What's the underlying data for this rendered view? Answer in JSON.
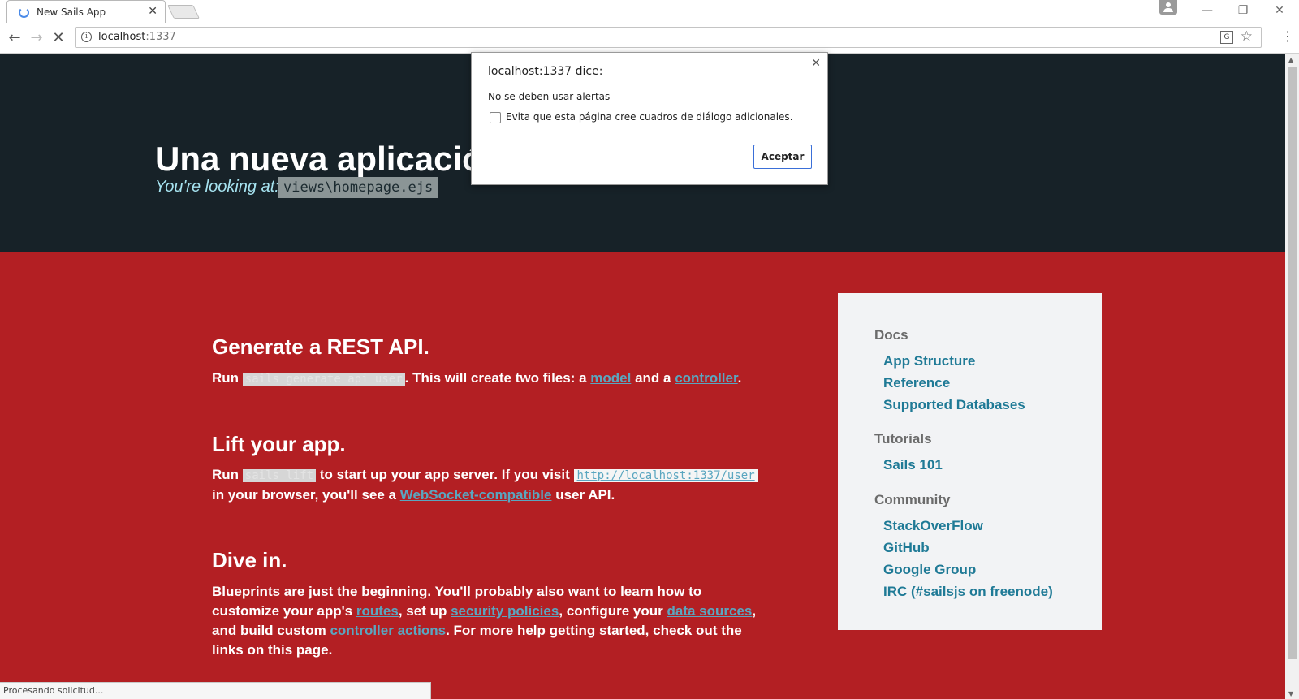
{
  "browser": {
    "tab_title": "New Sails App",
    "url_host": "localhost",
    "url_port": ":1337",
    "status_text": "Procesando solicitud..."
  },
  "header": {
    "title": "Una nueva aplicació",
    "looking_label": "You're looking at:",
    "file_path": "views\\homepage.ejs"
  },
  "sections": {
    "rest": {
      "title": "Generate a REST API.",
      "run": "Run",
      "command": "sails generate api user",
      "text1": ". This will create two files: a ",
      "link_model": "model",
      "and": " and a ",
      "link_controller": "controller",
      "end": "."
    },
    "lift": {
      "title": "Lift your app.",
      "run": "Run",
      "command": "sails lift",
      "text1": " to start up your app server. If you visit ",
      "url": "http://localhost:1337/user",
      "text2": " in your browser, you'll see a ",
      "link_ws": "WebSocket-compatible",
      "text3": " user API."
    },
    "dive": {
      "title": "Dive in.",
      "text1": "Blueprints are just the beginning. You'll probably also want to learn how to customize your app's ",
      "link_routes": "routes",
      "text2": ", set up ",
      "link_policies": "security policies",
      "text3": ", configure your ",
      "link_datasources": "data sources",
      "text4": ", and build custom ",
      "link_actions": "controller actions",
      "text5": ". For more help getting started, check out the links on this page."
    }
  },
  "sidebar": {
    "docs_heading": "Docs",
    "docs_links": [
      "App Structure",
      "Reference",
      "Supported Databases"
    ],
    "tutorials_heading": "Tutorials",
    "tutorials_links": [
      "Sails 101"
    ],
    "community_heading": "Community",
    "community_links": [
      "StackOverFlow",
      "GitHub",
      "Google Group",
      "IRC (#sailsjs on freenode)"
    ]
  },
  "dialog": {
    "title": "localhost:1337 dice:",
    "message": "No se deben usar alertas",
    "checkbox_label": "Evita que esta página cree cuadros de diálogo adicionales.",
    "ok_label": "Aceptar"
  }
}
